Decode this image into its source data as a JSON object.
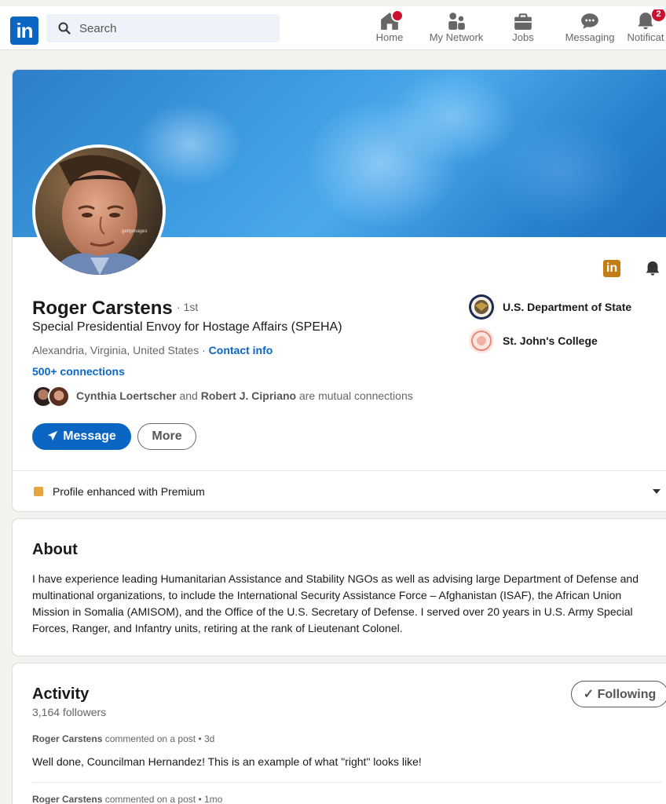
{
  "nav": {
    "logo": "in",
    "search_placeholder": "Search",
    "items": [
      {
        "label": "Home",
        "icon": "home-icon"
      },
      {
        "label": "My Network",
        "icon": "people-icon"
      },
      {
        "label": "Jobs",
        "icon": "briefcase-icon"
      },
      {
        "label": "Messaging",
        "icon": "chat-icon"
      },
      {
        "label": "Notificat",
        "icon": "bell-icon",
        "badge": "2"
      }
    ]
  },
  "profile": {
    "name": "Roger Carstens",
    "degree": "· 1st",
    "headline": "Special Presidential Envoy for Hostage Affairs (SPEHA)",
    "location": "Alexandria, Virginia, United States",
    "separator": " · ",
    "contact_label": "Contact info",
    "connections": "500+ connections",
    "mutual": {
      "person1": "Cynthia Loertscher",
      "joiner": " and ",
      "person2": "Robert J. Cipriano",
      "suffix": " are mutual connections"
    },
    "buttons": {
      "message": "Message",
      "more": "More"
    },
    "orgs": [
      {
        "name": "U.S. Department of State"
      },
      {
        "name": "St. John's College"
      }
    ],
    "premium_label": "Profile enhanced with Premium",
    "in_badge": "in"
  },
  "about": {
    "title": "About",
    "text": "I have experience leading Humanitarian Assistance and Stability NGOs as well as advising large Department of Defense and multinational organizations, to include the International Security Assistance Force – Afghanistan (ISAF), the African Union Mission in Somalia (AMISOM), and the Office of the U.S. Secretary of Defense. I served over 20 years in U.S. Army Special Forces, Ranger, and Infantry units, retiring at the rank of Lieutenant Colonel."
  },
  "activity": {
    "title": "Activity",
    "followers": "3,164 followers",
    "follow_button": "Following",
    "items": [
      {
        "author": "Roger Carstens",
        "meta": " commented on a post • 3d",
        "text": "Well done, Councilman Hernandez! This is an example of what \"right\" looks like!"
      },
      {
        "author": "Roger Carstens",
        "meta": " commented on a post • 1mo",
        "text": ""
      }
    ]
  },
  "colors": {
    "brand": "#0a66c2",
    "badge": "#cb112d",
    "premium": "#e7a33e"
  }
}
